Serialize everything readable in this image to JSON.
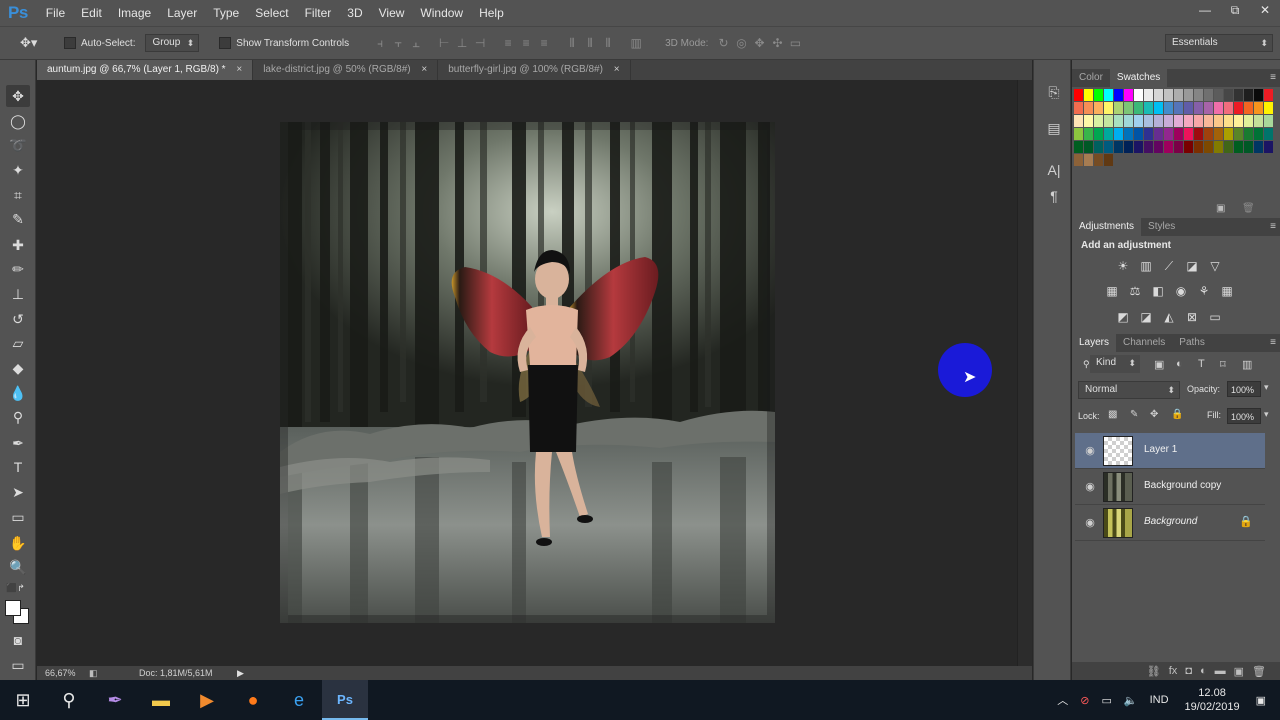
{
  "app": {
    "logo": "Ps"
  },
  "menu": [
    "File",
    "Edit",
    "Image",
    "Layer",
    "Type",
    "Select",
    "Filter",
    "3D",
    "View",
    "Window",
    "Help"
  ],
  "window_controls": {
    "minimize": "—",
    "restore": "⧉",
    "close": "✕"
  },
  "options_bar": {
    "auto_select_label": "Auto-Select:",
    "auto_select_value": "Group",
    "transform_label": "Show Transform Controls",
    "mode_3d_label": "3D Mode:",
    "workspace_value": "Essentials"
  },
  "documents": [
    {
      "label": "auntum.jpg @ 66,7% (Layer 1, RGB/8) *",
      "close": "×"
    },
    {
      "label": "lake-district.jpg @ 50% (RGB/8#)",
      "close": "×"
    },
    {
      "label": "butterfly-girl.jpg @ 100% (RGB/8#)",
      "close": "×"
    }
  ],
  "status": {
    "zoom": "66,67%",
    "doc": "Doc: 1,81M/5,61M"
  },
  "color_panel": {
    "tabs": [
      "Color",
      "Swatches"
    ]
  },
  "adjustments_panel": {
    "tabs": [
      "Adjustments",
      "Styles"
    ],
    "title": "Add an adjustment"
  },
  "layers_panel": {
    "tabs": [
      "Layers",
      "Channels",
      "Paths"
    ],
    "kind_value": "Kind",
    "blend_mode": "Normal",
    "opacity_label": "Opacity:",
    "opacity_value": "100%",
    "lock_label": "Lock:",
    "fill_label": "Fill:",
    "fill_value": "100%",
    "layers": [
      {
        "name": "Layer 1",
        "selected": true
      },
      {
        "name": "Background copy",
        "selected": false
      },
      {
        "name": "Background",
        "selected": false,
        "locked": true
      }
    ]
  },
  "taskbar": {
    "tray_lang": "IND",
    "time": "12.08",
    "date": "19/02/2019"
  },
  "colors": {
    "menu_bg": "#535353",
    "canvas_bg": "#282828",
    "selected_layer": "#5f6f8a",
    "cursor_dot": "#1a1ad8",
    "ps_blue": "#3a8fd9"
  }
}
